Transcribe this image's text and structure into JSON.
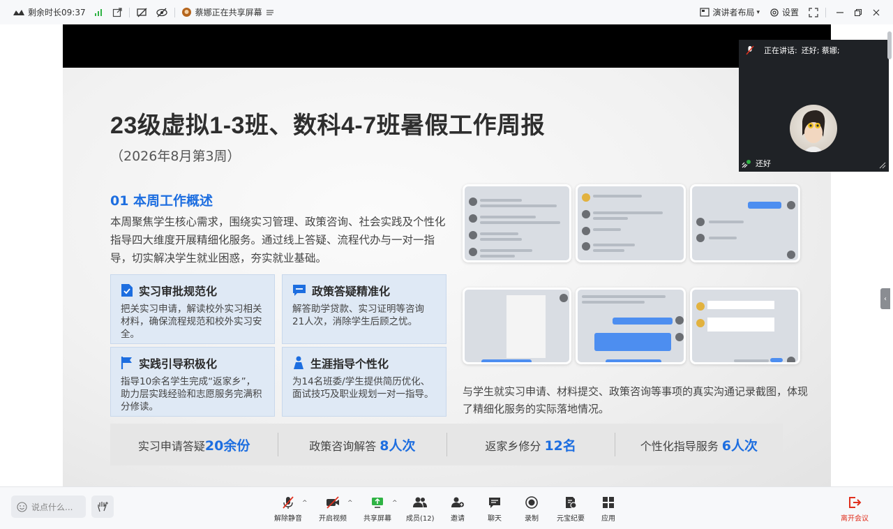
{
  "topbar": {
    "time_label": "剩余时长09:37",
    "sharing_text": "蔡娜正在共享屏幕",
    "layout_label": "演讲者布局",
    "settings_label": "设置"
  },
  "slide": {
    "title": "23级虚拟1-3班、数科4-7班暑假工作周报",
    "subtitle": "（2026年8月第3周）",
    "section_heading": "01 本周工作概述",
    "section_body": "本周聚焦学生核心需求，围绕实习管理、政策咨询、社会实践及个性化指导四大维度开展精细化服务。通过线上答疑、流程代办与一对一指导，切实解决学生就业困惑，夯实就业基础。",
    "cards": [
      {
        "title": "实习审批规范化",
        "body": "把关实习申请，解读校外实习相关材料，确保流程规范和校外实习安全。"
      },
      {
        "title": "政策答疑精准化",
        "body": "解答助学贷款、实习证明等咨询21人次，消除学生后顾之忧。"
      },
      {
        "title": "实践引导积极化",
        "body": "指导10余名学生完成“返家乡”，助力层实践经验和志愿服务完满积分修读。"
      },
      {
        "title": "生涯指导个性化",
        "body": "为14名班委/学生提供简历优化、面试技巧及职业规划一对一指导。"
      }
    ],
    "screenshot_caption": "与学生就实习申请、材料提交、政策咨询等事项的真实沟通记录截图，体现了精细化服务的实际落地情况。",
    "stats": [
      {
        "label": "实习申请答疑",
        "value": "20余份"
      },
      {
        "label": "政策咨询解答 ",
        "value": "8人次"
      },
      {
        "label": "返家乡修分 ",
        "value": "12名"
      },
      {
        "label": "个性化指导服务 ",
        "value": "6人次"
      }
    ]
  },
  "video": {
    "speaking_label": "正在讲话:",
    "speaking_names": "还好; 蔡娜;",
    "participant_name": "还好"
  },
  "annotate_label": "批注",
  "bottombar": {
    "chat_placeholder": "说点什么...",
    "tools": [
      {
        "label": "解除静音"
      },
      {
        "label": "开启视频"
      },
      {
        "label": "共享屏幕"
      },
      {
        "label": "成员(12)"
      },
      {
        "label": "邀请"
      },
      {
        "label": "聊天"
      },
      {
        "label": "录制"
      },
      {
        "label": "元宝纪要"
      },
      {
        "label": "应用"
      }
    ],
    "leave_label": "离开会议"
  },
  "colors": {
    "accent": "#1d6ee0",
    "leave": "#e0301e",
    "card_bg": "#dfe9f5"
  }
}
